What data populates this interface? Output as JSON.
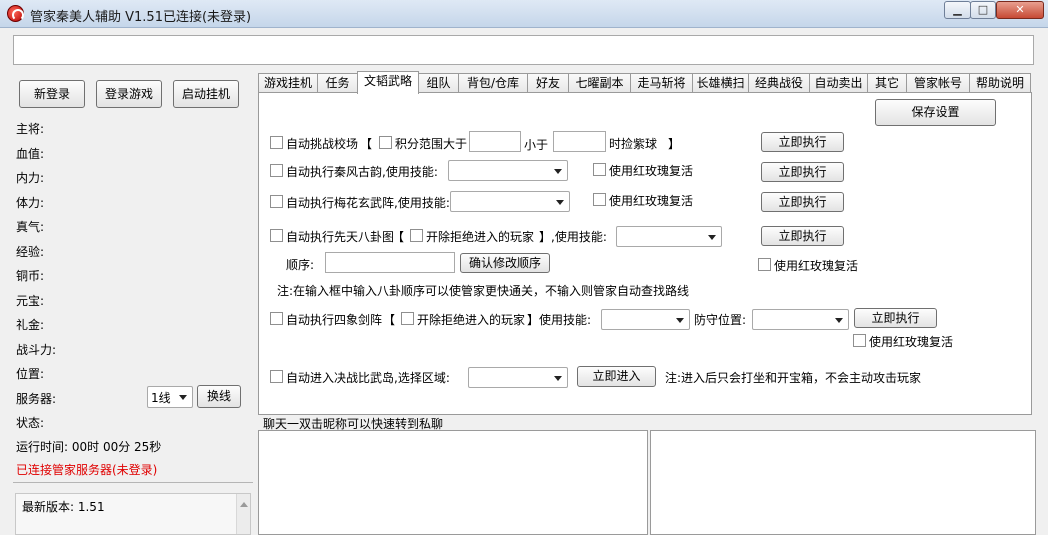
{
  "window": {
    "title": "管家秦美人辅助 V1.51已连接(未登录)",
    "min_glyph": "▁",
    "max_glyph": "□",
    "close_glyph": "✕"
  },
  "left": {
    "buttons": {
      "new_login": "新登录",
      "login_game": "登录游戏",
      "start_hangup": "启动挂机"
    },
    "fields": {
      "zhujiang": "主将:",
      "xuezhi": "血值:",
      "neili": "内力:",
      "tili": "体力:",
      "zhenqi": "真气:",
      "jingyan": "经验:",
      "tongbi": "铜币:",
      "yuanbao": "元宝:",
      "lijin": "礼金:",
      "zhandouli": "战斗力:",
      "weizhi": "位置:",
      "fuwuqi": "服务器:",
      "zhuangtai": "状态:"
    },
    "server_line": "1线",
    "switch_line": "换线",
    "runtime": "运行时间: 00时 00分 25秒",
    "connected": "已连接管家服务器(未登录)",
    "version": "最新版本: 1.51"
  },
  "tabs": [
    "游戏挂机",
    "任务",
    "文韬武略",
    "组队",
    "背包/仓库",
    "好友",
    "七曜副本",
    "走马斩将",
    "长雄横扫",
    "经典战役",
    "自动卖出",
    "其它",
    "管家帐号",
    "帮助说明"
  ],
  "panel": {
    "save_settings": "保存设置",
    "row1": {
      "auto_challenge": "自动挑战校场",
      "bracket_open": "【",
      "score_range": "积分范围大于",
      "less_than": "小于",
      "pick_purple": "时捡紫球",
      "bracket_close": "】",
      "execute": "立即执行"
    },
    "row2": {
      "label": "自动执行秦风古韵,使用技能:",
      "revive": "使用红玫瑰复活",
      "execute": "立即执行"
    },
    "row3": {
      "label": "自动执行梅花玄武阵,使用技能:",
      "revive": "使用红玫瑰复活",
      "execute": "立即执行"
    },
    "row4": {
      "label": "自动执行先天八卦图",
      "bracket_open": "【",
      "exclude": "开除拒绝进入的玩家",
      "bracket_close": "】,使用技能:",
      "execute": "立即执行",
      "order_label": "顺序:",
      "confirm_order": "确认修改顺序",
      "revive": "使用红玫瑰复活",
      "note": "注:在输入框中输入八卦顺序可以使管家更快通关，不输入则管家自动查找路线"
    },
    "row5": {
      "label": "自动执行四象剑阵",
      "bracket_open": "【",
      "exclude": "开除拒绝进入的玩家",
      "bracket_close": "】使用技能:",
      "defend": "防守位置:",
      "execute": "立即执行",
      "revive": "使用红玫瑰复活"
    },
    "row6": {
      "label": "自动进入决战比武岛,选择区域:",
      "enter": "立即进入",
      "note": "注:进入后只会打坐和开宝箱，不会主动攻击玩家"
    }
  },
  "chat": {
    "label": "聊天一双击昵称可以快速转到私聊"
  }
}
